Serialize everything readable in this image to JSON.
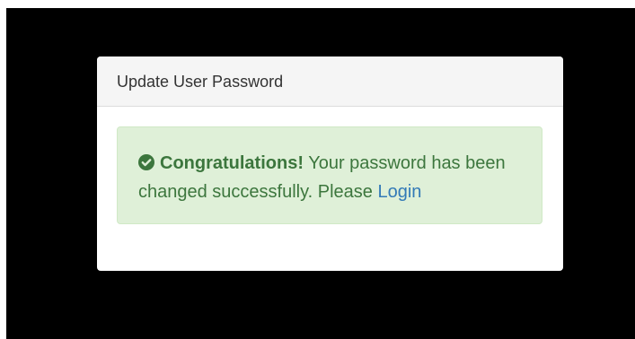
{
  "panel": {
    "title": "Update User Password"
  },
  "alert": {
    "icon": "check-circle-icon",
    "strong_text": "Congratulations!",
    "message": " Your password has been changed successfully. Please ",
    "link_label": "Login",
    "colors": {
      "background": "#dff0d8",
      "text": "#3c763d",
      "link": "#337ab7"
    }
  }
}
